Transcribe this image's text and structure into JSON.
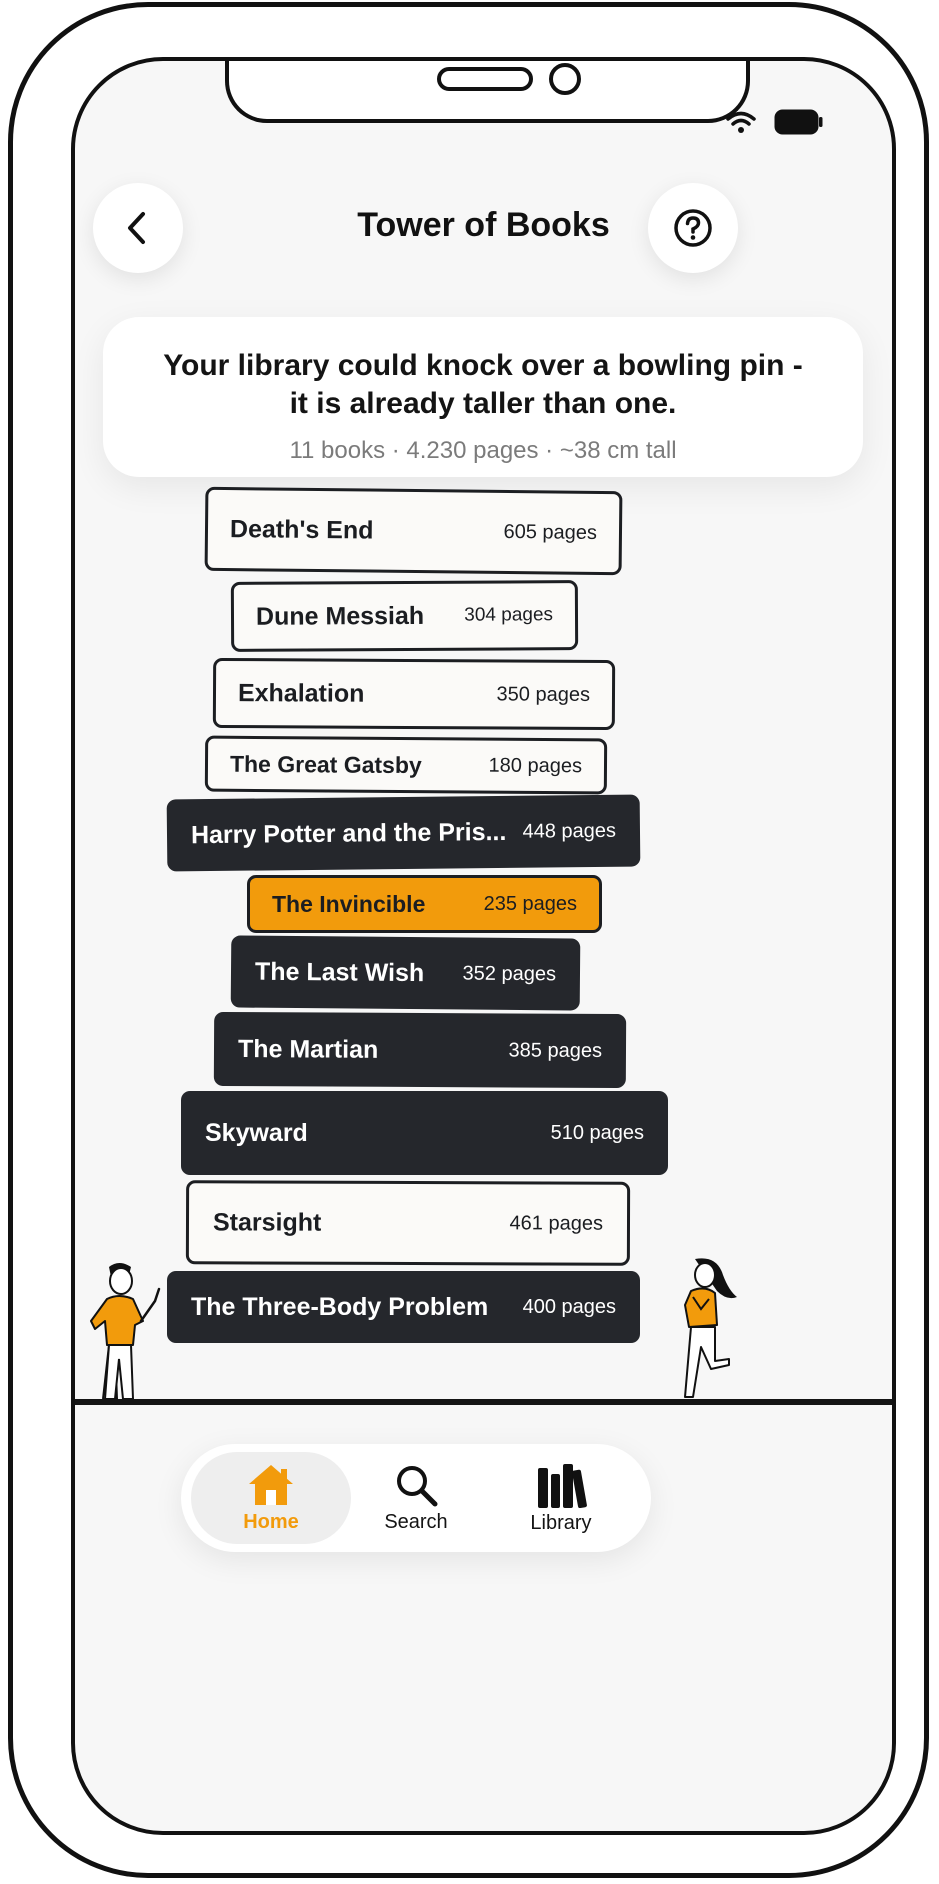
{
  "header": {
    "title": "Tower of Books",
    "back_icon": "chevron-left-icon",
    "help_icon": "help-circle-icon"
  },
  "status_bar": {
    "icons": [
      "wifi-icon",
      "battery-icon"
    ]
  },
  "summary": {
    "headline_line1": "Your library could knock over a bowling pin -",
    "headline_line2": "it is already taller than one.",
    "stats": "11 books · 4.230 pages · ~38 cm tall"
  },
  "books": [
    {
      "title": "Death's End",
      "pages": "605 pages",
      "style": "light"
    },
    {
      "title": "Dune Messiah",
      "pages": "304 pages",
      "style": "light"
    },
    {
      "title": "Exhalation",
      "pages": "350 pages",
      "style": "light"
    },
    {
      "title": "The Great Gatsby",
      "pages": "180 pages",
      "style": "light"
    },
    {
      "title": "Harry Potter and the Pris...",
      "pages": "448 pages",
      "style": "dark"
    },
    {
      "title": "The Invincible",
      "pages": "235 pages",
      "style": "accent"
    },
    {
      "title": "The Last Wish",
      "pages": "352 pages",
      "style": "dark"
    },
    {
      "title": "The Martian",
      "pages": "385 pages",
      "style": "dark"
    },
    {
      "title": "Skyward",
      "pages": "510 pages",
      "style": "dark"
    },
    {
      "title": "Starsight",
      "pages": "461 pages",
      "style": "light"
    },
    {
      "title": "The Three-Body Problem",
      "pages": "400 pages",
      "style": "dark"
    }
  ],
  "colors": {
    "accent": "#f29b0c",
    "dark_book": "#25272c",
    "light_book": "#fbfaf8",
    "background": "#f7f7f7"
  },
  "nav": {
    "items": [
      {
        "label": "Home",
        "icon": "home-icon",
        "active": true
      },
      {
        "label": "Search",
        "icon": "search-icon",
        "active": false
      },
      {
        "label": "Library",
        "icon": "library-icon",
        "active": false
      }
    ]
  }
}
